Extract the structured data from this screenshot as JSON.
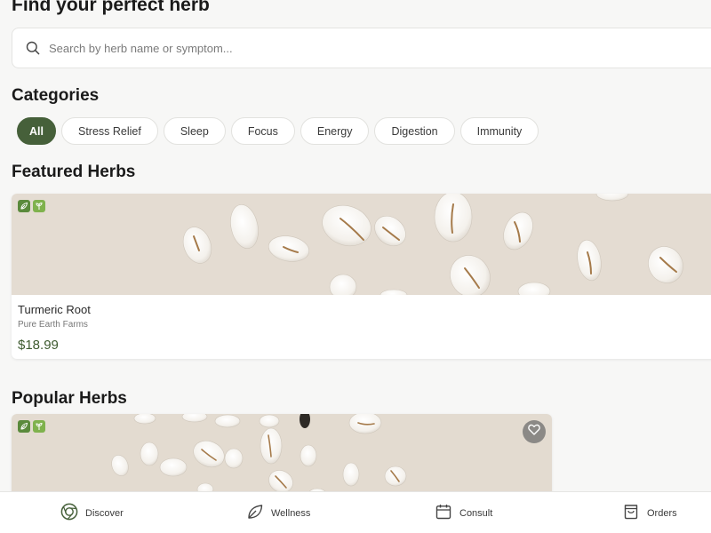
{
  "header": {
    "title": "Find your perfect herb"
  },
  "search": {
    "placeholder": "Search by herb name or symptom..."
  },
  "categories": {
    "title": "Categories",
    "items": [
      {
        "label": "All",
        "active": true
      },
      {
        "label": "Stress Relief",
        "active": false
      },
      {
        "label": "Sleep",
        "active": false
      },
      {
        "label": "Focus",
        "active": false
      },
      {
        "label": "Energy",
        "active": false
      },
      {
        "label": "Digestion",
        "active": false
      },
      {
        "label": "Immunity",
        "active": false
      }
    ]
  },
  "featured": {
    "title": "Featured Herbs",
    "items": [
      {
        "name": "Turmeric Root",
        "vendor": "Pure Earth Farms",
        "price": "$18.99",
        "badges": [
          "leaf-icon",
          "sprout-icon"
        ]
      }
    ]
  },
  "popular": {
    "title": "Popular Herbs",
    "items": [
      {
        "badges": [
          "leaf-icon",
          "sprout-icon"
        ],
        "favorite_icon": "heart-icon"
      }
    ]
  },
  "nav": {
    "items": [
      {
        "label": "Discover",
        "icon": "discover-icon",
        "active": true
      },
      {
        "label": "Wellness",
        "icon": "leaf-icon",
        "active": false
      },
      {
        "label": "Consult",
        "icon": "calendar-icon",
        "active": false
      },
      {
        "label": "Orders",
        "icon": "bag-icon",
        "active": false
      }
    ]
  },
  "colors": {
    "accent": "#46603a",
    "price": "#3d5a2e",
    "background": "#f7f7f6",
    "photo_background": "#e4dcd2"
  }
}
